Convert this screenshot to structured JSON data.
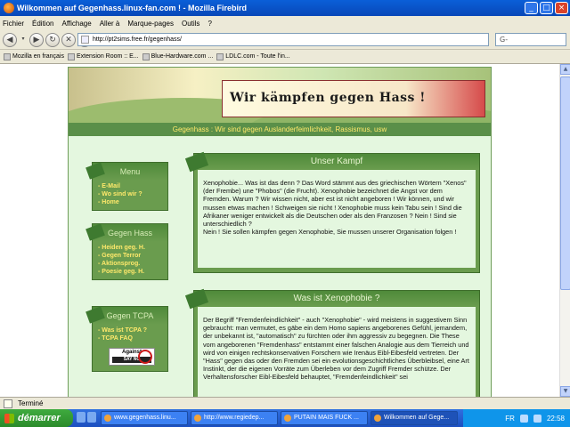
{
  "window": {
    "title": "Wilkommen auf Gegenhass.linux-fan.com ! - Mozilla Firebird"
  },
  "menu": [
    "Fichier",
    "Édition",
    "Affichage",
    "Aller à",
    "Marque-pages",
    "Outils",
    "?"
  ],
  "nav": {
    "url": "http://pt2sims.free.fr/gegenhass/",
    "search_placeholder": "G-"
  },
  "bookmarks": [
    "Mozilla en français",
    "Extension Room :: E...",
    "Blue-Hardware.com ...",
    "LDLC.com - Toute l'in..."
  ],
  "site": {
    "slogan": "Wir kämpfen gegen Hass !",
    "subtitle": "Gegenhass : Wir sind gegen Auslanderfeimlichkeit, Rassismus, usw",
    "menu_box": {
      "title": "Menu",
      "items": [
        "- E-Mail",
        "- Wo sind wir ?",
        "- Home"
      ]
    },
    "hass_box": {
      "title": "Gegen Hass",
      "items": [
        "- Heiden geg. H.",
        "- Gegen Terror",
        "- Aktionsprog.",
        "- Poesie geg. H."
      ]
    },
    "tcpa_box": {
      "title": "Gegen TCPA",
      "items": [
        "- Was ist TCPA ?",
        "- TCPA FAQ"
      ],
      "badge": "Against",
      "badge_sub": "SAY NO"
    },
    "kampf": {
      "title": "Unser Kampf",
      "text": "Xenophobie... Was ist das denn ? Das Word stämmt aus des griechischen Wörtern \"Xenos\" (der Frembe) une \"Phobos\" (die Frucht). Xenophobie bezeichnet die Angst vor dem Fremden. Warum ? Wir wissen nicht, aber est ist nicht angeboren ! Wir können, und wir mussen etwas machen ! Schweigen sie nicht ! Xenophobie muss kein Tabu sein ! Sind die Afrikaner weniger entwickelt als die Deutschen oder als den Franzosen ? Nein ! Sind sie unterschiedlich ?\nNein ! Sie sollen kämpfen gegen Xenophobie, Sie mussen unserer Organisation folgen !"
    },
    "xeno": {
      "title": "Was ist Xenophobie ?",
      "text": "Der Begriff \"Fremdenfeindlichkeit\" - auch \"Xenophobie\" - wird meistens in suggestivem Sinn gebraucht: man vermutet, es gäbe ein dem Homo sapiens angeborenes Gefühl, jemandem, der unbekannt ist, \"automatisch\" zu fürchten oder ihm aggressiv zu begegnen. Die These vom angeborenen \"Fremdenhass\" entstammt einer falschen Analogie aus dem Tierreich und wird von einigen rechtskonservativen Forschern wie Irenäus Eibl-Eibesfeld vertreten. Der \"Hass\" gegen das oder den Fremden sei ein evolutionsgeschichtliches Überbleibsel, eine Art Instinkt, der die eigenen Vorräte zum Überleben vor dem Zugriff Fremder schütze. Der Verhaltensforscher Eibl-Eibesfeld behauptet, \"Fremdenfeindlichkeit\" sei"
    }
  },
  "status": {
    "text": "Terminé"
  },
  "taskbar": {
    "start": "démarrer",
    "tasks": [
      "www.gegenhass.linu...",
      "http://www.regiedep...",
      "PUTAIN MAIS FUCK ...",
      "Wilkommen auf Gege..."
    ],
    "lang": "FR",
    "clock": "22:58"
  }
}
